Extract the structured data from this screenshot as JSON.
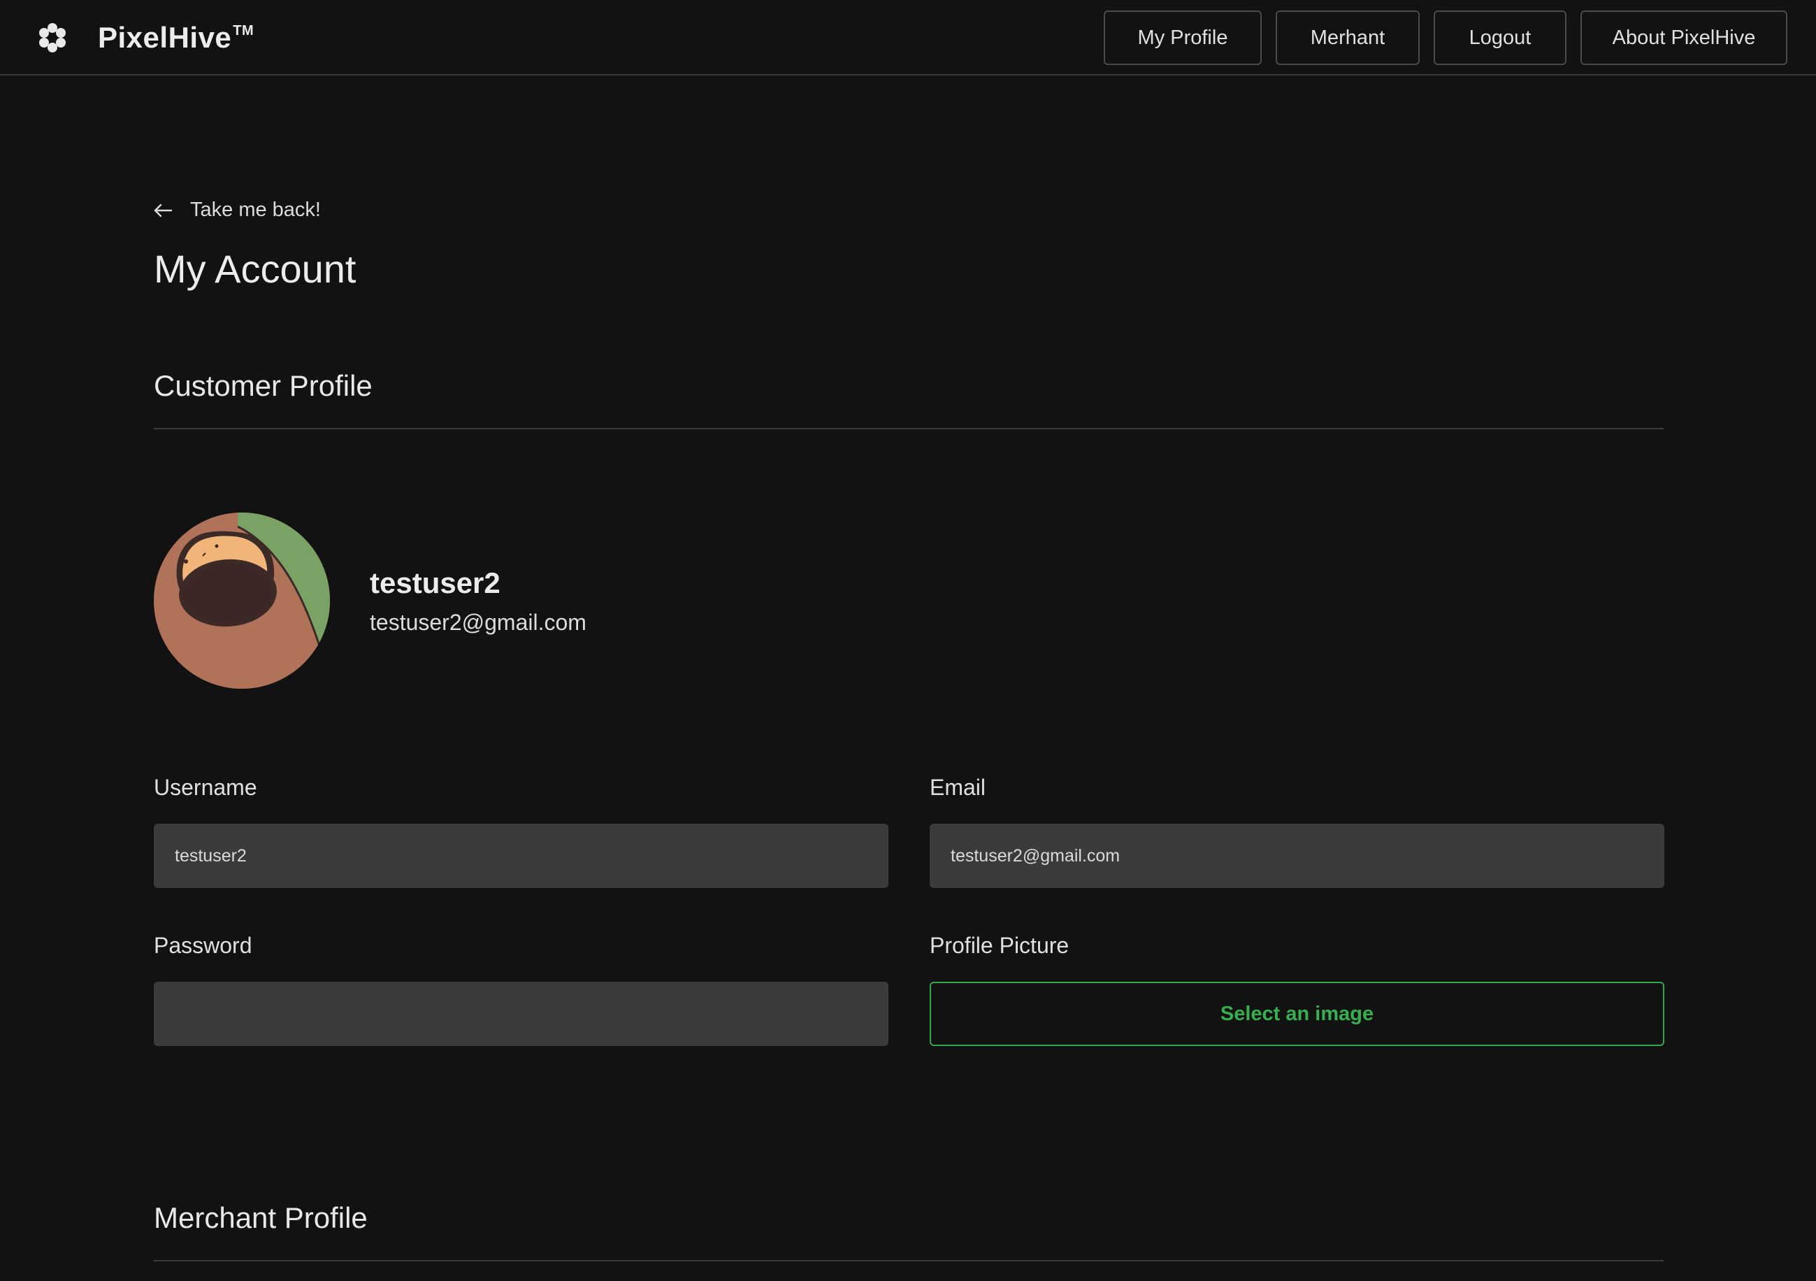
{
  "brand": {
    "name": "PixelHive",
    "trademark": "TM",
    "logo_icon": "honeycomb-flower-icon"
  },
  "nav": {
    "my_profile": "My Profile",
    "merchant": "Merhant",
    "logout": "Logout",
    "about": "About PixelHive"
  },
  "back_link": {
    "label": "Take me back!",
    "icon": "arrow-left-icon"
  },
  "page_title": "My Account",
  "customer_profile": {
    "title": "Customer Profile",
    "display_name": "testuser2",
    "display_email": "testuser2@gmail.com",
    "avatar_icon": "avatar-image"
  },
  "form": {
    "username_label": "Username",
    "username_value": "testuser2",
    "email_label": "Email",
    "email_value": "testuser2@gmail.com",
    "password_label": "Password",
    "password_value": "",
    "picture_label": "Profile Picture",
    "picture_button": "Select an image"
  },
  "merchant_profile": {
    "title": "Merchant Profile"
  },
  "colors": {
    "background": "#121212",
    "input_background": "#3b3b3b",
    "accent_green": "#36b04f",
    "border": "#4a4a4a"
  }
}
